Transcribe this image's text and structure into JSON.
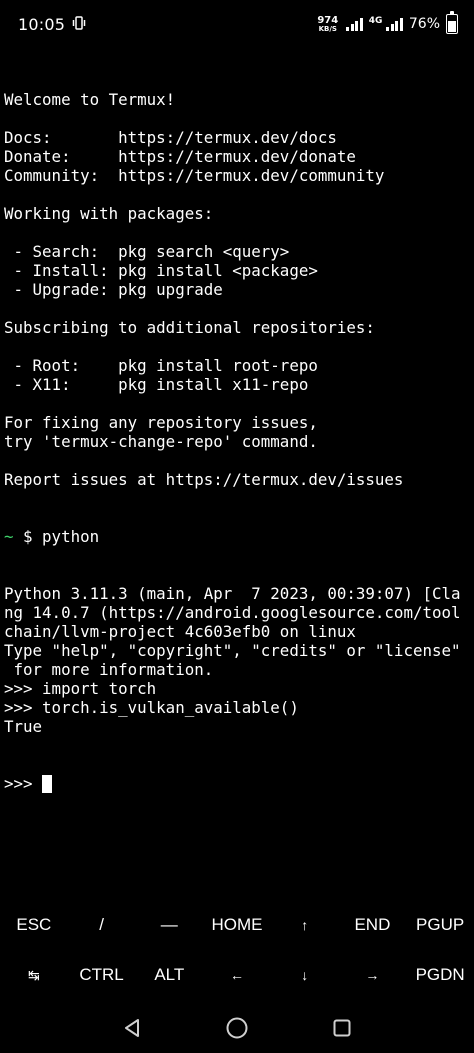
{
  "status_bar": {
    "time": "10:05",
    "vibrate_icon": "vibrate-icon",
    "net_speed_value": "974",
    "net_speed_unit": "KB/S",
    "network_type": "4G",
    "battery_percent": "76%",
    "battery_level": 0.76
  },
  "terminal": {
    "lines": [
      "Welcome to Termux!",
      "",
      "Docs:       https://termux.dev/docs",
      "Donate:     https://termux.dev/donate",
      "Community:  https://termux.dev/community",
      "",
      "Working with packages:",
      "",
      " - Search:  pkg search <query>",
      " - Install: pkg install <package>",
      " - Upgrade: pkg upgrade",
      "",
      "Subscribing to additional repositories:",
      "",
      " - Root:    pkg install root-repo",
      " - X11:     pkg install x11-repo",
      "",
      "For fixing any repository issues,",
      "try 'termux-change-repo' command.",
      "",
      "Report issues at https://termux.dev/issues"
    ],
    "shell_prompt_tilde": "~",
    "shell_command": " $ python",
    "output_lines": [
      "Python 3.11.3 (main, Apr  7 2023, 00:39:07) [Cla",
      "ng 14.0.7 (https://android.googlesource.com/tool",
      "chain/llvm-project 4c603efb0 on linux",
      "Type \"help\", \"copyright\", \"credits\" or \"license\"",
      " for more information.",
      ">>> import torch",
      ">>> torch.is_vulkan_available()",
      "True"
    ],
    "current_prompt": ">>> "
  },
  "extra_keys": {
    "row1": [
      "ESC",
      "/",
      "—",
      "HOME",
      "↑",
      "END",
      "PGUP"
    ],
    "row2": [
      "↹",
      "CTRL",
      "ALT",
      "←",
      "↓",
      "→",
      "PGDN"
    ]
  },
  "nav_bar": {
    "back_icon": "back-triangle-icon",
    "home_icon": "home-circle-icon",
    "recents_icon": "recents-square-icon"
  }
}
